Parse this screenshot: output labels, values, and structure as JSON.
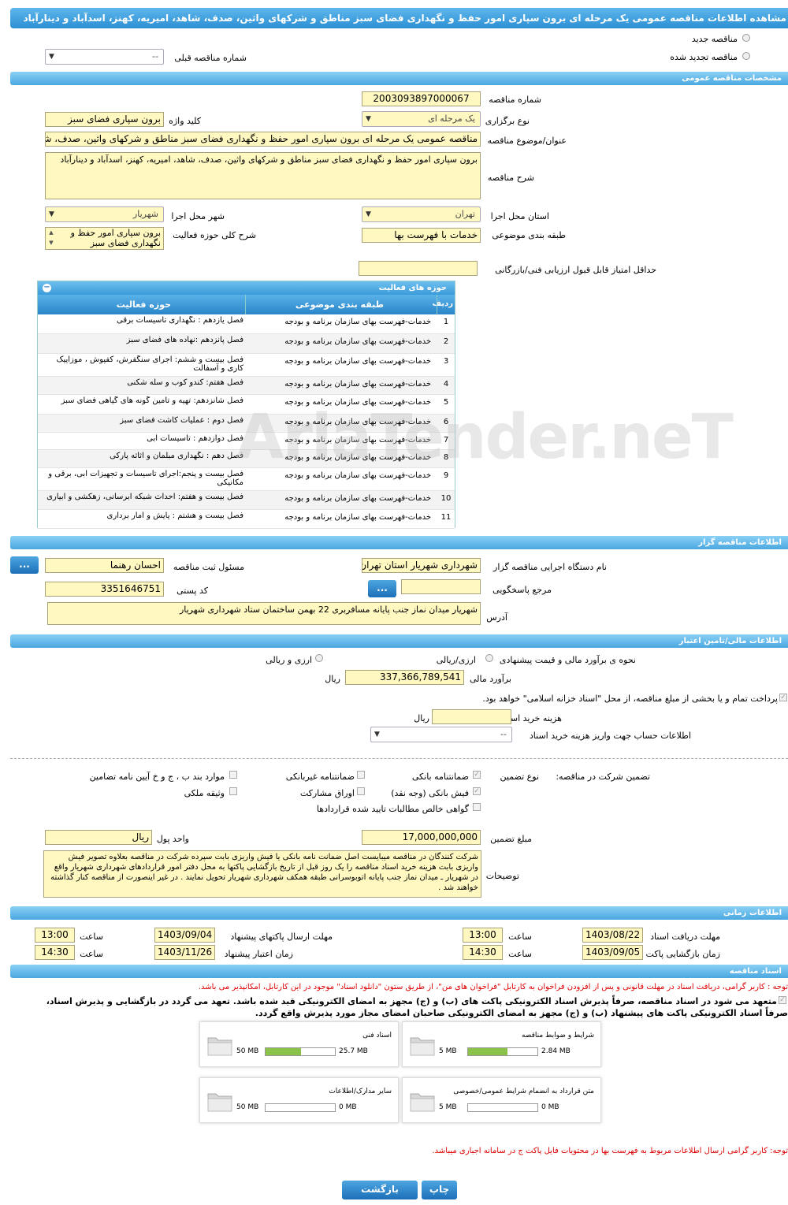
{
  "title": "مشاهده اطلاعات مناقصه عمومی یک مرحله ای برون سپاری امور حفظ و نگهداری فضای سبز مناطق و شرکهای واثین، صدف، شاهد، امیریه، کهنز، اسدآباد و دینارآباد",
  "tender_type": {
    "new": "مناقصه جدید",
    "renewed": "مناقصه تجدید شده",
    "prev_label": "شماره مناقصه قبلی",
    "prev_value": "--"
  },
  "general": {
    "header": "مشخصات مناقصه عمومی",
    "number_label": "شماره مناقصه",
    "number": "2003093897000067",
    "holding_label": "نوع برگزاری",
    "holding": "یک مرحله ای",
    "keyword_label": "کلید واژه",
    "keyword": "برون سپاری فضای سبز",
    "subject_label": "عنوان/موضوع مناقصه",
    "subject": "مناقصه عمومی یک مرحله ای برون سپاری امور حفظ و نگهداری فضای سبز مناطق و شرکهای واثین، صدف، شاهد،",
    "desc_label": "شرح مناقصه",
    "desc": "برون سپاری امور حفظ و نگهداری فضای سبز مناطق و شرکهای واثین، صدف، شاهد، امیریه، کهنز، اسدآباد و دینارآباد",
    "province_label": "استان محل اجرا",
    "province": "تهران",
    "city_label": "شهر محل اجرا",
    "city": "شهریار",
    "category_label": "طبقه بندی موضوعی",
    "category": "خدمات با فهرست بها",
    "scope_label": "شرح کلی حوزه فعالیت",
    "scope": "برون سپاری امور حفظ و نگهداری فضای سبز",
    "min_score_label": "حداقل امتیاز قابل قبول ارزیابی فنی/بازرگانی",
    "min_score": ""
  },
  "activities": {
    "header": "حوزه های فعالیت",
    "col_row": "ردیف",
    "col_cat": "طبقه بندی موضوعی",
    "col_field": "حوزه فعالیت",
    "rows": [
      {
        "n": "1",
        "cat": "خدمات-فهرست بهای سازمان برنامه و بودجه",
        "field": "فصل یازدهم : نگهداری تاسیسات برقی"
      },
      {
        "n": "2",
        "cat": "خدمات-فهرست بهای سازمان برنامه و بودجه",
        "field": "فصل پانزدهم :نهاده های فضای سبز"
      },
      {
        "n": "3",
        "cat": "خدمات-فهرست بهای سازمان برنامه و بودجه",
        "field": "فصل بیست و ششم: اجرای سنگفرش، کفپوش ، موزاییک کاری و آسفالت"
      },
      {
        "n": "4",
        "cat": "خدمات-فهرست بهای سازمان برنامه و بودجه",
        "field": "فصل هفتم: کندو کوب و سله شکنی"
      },
      {
        "n": "5",
        "cat": "خدمات-فهرست بهای سازمان برنامه و بودجه",
        "field": "فصل شانزدهم: تهیه و تامین گونه های گیاهی فضای سبز"
      },
      {
        "n": "6",
        "cat": "خدمات-فهرست بهای سازمان برنامه و بودجه",
        "field": "فصل دوم : عملیات کاشت فضای سبز"
      },
      {
        "n": "7",
        "cat": "خدمات-فهرست بهای سازمان برنامه و بودجه",
        "field": "فصل دوازدهم : تاسیسات آبی"
      },
      {
        "n": "8",
        "cat": "خدمات-فهرست بهای سازمان برنامه و بودجه",
        "field": "فصل دهم : نگهداری مبلمان و اثاثه پارکی"
      },
      {
        "n": "9",
        "cat": "خدمات-فهرست بهای سازمان برنامه و بودجه",
        "field": "فصل بیست و پنجم:اجرای تاسیسات و تجهیزات آبی، برقی و مکانیکی"
      },
      {
        "n": "10",
        "cat": "خدمات-فهرست بهای سازمان برنامه و بودجه",
        "field": "فصل بیست و هفتم: احداث شبکه آبرسانی، زهکشی و آبیاری"
      },
      {
        "n": "11",
        "cat": "خدمات-فهرست بهای سازمان برنامه و بودجه",
        "field": "فصل بیست و هشتم : پایش و آمار برداری"
      }
    ]
  },
  "organizer": {
    "header": "اطلاعات مناقصه گزار",
    "org_label": "نام دستگاه اجرایی مناقصه گزار",
    "org": "شهرداری شهریار استان تهران",
    "reg_label": "مسئول ثبت مناقصه",
    "reg": "احسان رهنما",
    "ref_label": "مرجع پاسخگویی",
    "ref": "",
    "postal_label": "کد پستی",
    "postal": "3351646751",
    "address_label": "آدرس",
    "address": "شهریار میدان نماز  جنب پایانه مسافربری  22 بهمن ساختمان ستاد شهرداری شهریار",
    "btn": "..."
  },
  "finance": {
    "header": "اطلاعات مالی/تامین اعتبار",
    "method_label": "نحوه ی برآورد مالی و قیمت پیشنهادی",
    "opt1": "ارزی/ریالی",
    "opt2": "ارزی و ریالی",
    "estimate_label": "برآورد مالی",
    "estimate": "337,366,789,541",
    "rial": "ریال",
    "treasury": "پرداخت تمام و یا بخشی از مبلغ مناقصه، از محل \"اسناد خزانه اسلامی\" خواهد بود.",
    "doc_fee_label": "هزینه خرید اسناد",
    "doc_fee": "",
    "account_label": "اطلاعات حساب جهت واریز هزینه خرید اسناد",
    "account": "--"
  },
  "guarantee": {
    "label": "تضمین شرکت در مناقصه:",
    "type_label": "نوع تضمین",
    "bank": "ضمانتنامه بانکی",
    "nonbank": "ضمانتنامه غیربانکی",
    "items_bcj": "موارد بند ب ، ج و خ آیین نامه تضامین",
    "cash": "فیش بانکی (وجه نقد)",
    "bonds": "اوراق مشارکت",
    "property": "وثیقه ملکی",
    "claims": "گواهی خالص مطالبات تایید شده قراردادها",
    "amount_label": "مبلغ تضمین",
    "amount": "17,000,000,000",
    "currency_label": "واحد پول",
    "currency": "ریال",
    "notes_label": "توضیحات",
    "notes": "شرکت کنندگان در مناقصه میبایست اصل ضمانت نامه بانکی یا فیش واریزی بابت سپرده شرکت در مناقصه بعلاوه تصویر فیش واریزی بابت هزینه خرید اسناد مناقصه را یک روز قبل از تاریخ بازگشایی پاکتها به محل دفتر امور قراردادهای شهرداری شهریار واقع در شهریار ـ میدان نماز جنب پایانه اتوبوسرانی طبقه همکف شهرداری شهریار تحویل نمایند . در غیر اینصورت از مناقصه کنار گذاشته خواهند شد ."
  },
  "timing": {
    "header": "اطلاعات زمانی",
    "recv_label": "مهلت دریافت اسناد",
    "recv_date": "1403/08/22",
    "recv_time": "13:00",
    "send_label": "مهلت ارسال پاکتهای پیشنهاد",
    "send_date": "1403/09/04",
    "send_time": "13:00",
    "open_label": "زمان بازگشایی پاکت ها",
    "open_date": "1403/09/05",
    "open_time": "14:30",
    "valid_label": "زمان اعتبار پیشنهاد",
    "valid_date": "1403/11/26",
    "valid_time": "14:30",
    "time_label": "ساعت"
  },
  "documents": {
    "header": "اسناد مناقصه",
    "note1": "توجه : کاربر گرامی، دریافت اسناد در مهلت قانونی و پس از افزودن فراخوان به کارتابل \"فراخوان های من\"، از طریق ستون \"دانلود اسناد\" موجود در این کارتابل، امکانپذیر می باشد.",
    "commit1": "متعهد می شود در اسناد مناقصه، صرفاً پذیرش اسناد الکترونیکی پاکت های (ب) و (ج) مجهز به امضای الکترونیکی قید شده باشد. تعهد می گردد در بازگشایی و پذیرش اسناد،",
    "commit2": "صرفاً اسناد الکترونیکی پاکت های پیشنهاد (ب) و (ج) مجهز به امضای الکترونیکی صاحبان امضای مجاز مورد پذیرش واقع گردد.",
    "items": [
      {
        "title": "شرایط و ضوابط مناقصه",
        "used": "2.84 MB",
        "max": "5 MB",
        "pct": 57
      },
      {
        "title": "اسناد فنی",
        "used": "25.7 MB",
        "max": "50 MB",
        "pct": 51
      },
      {
        "title": "متن قرارداد به انضمام شرایط عمومی/خصوصی",
        "used": "0 MB",
        "max": "5 MB",
        "pct": 0
      },
      {
        "title": "سایر مدارک/اطلاعات",
        "used": "0 MB",
        "max": "50 MB",
        "pct": 0
      }
    ],
    "note2": "توجه: کاربر گرامی ارسال اطلاعات مربوط به فهرست بها در محتویات فایل پاکت ج در سامانه اجباری میباشد."
  },
  "buttons": {
    "print": "چاپ",
    "back": "بازگشت"
  },
  "watermark": "AriaTender.neT"
}
